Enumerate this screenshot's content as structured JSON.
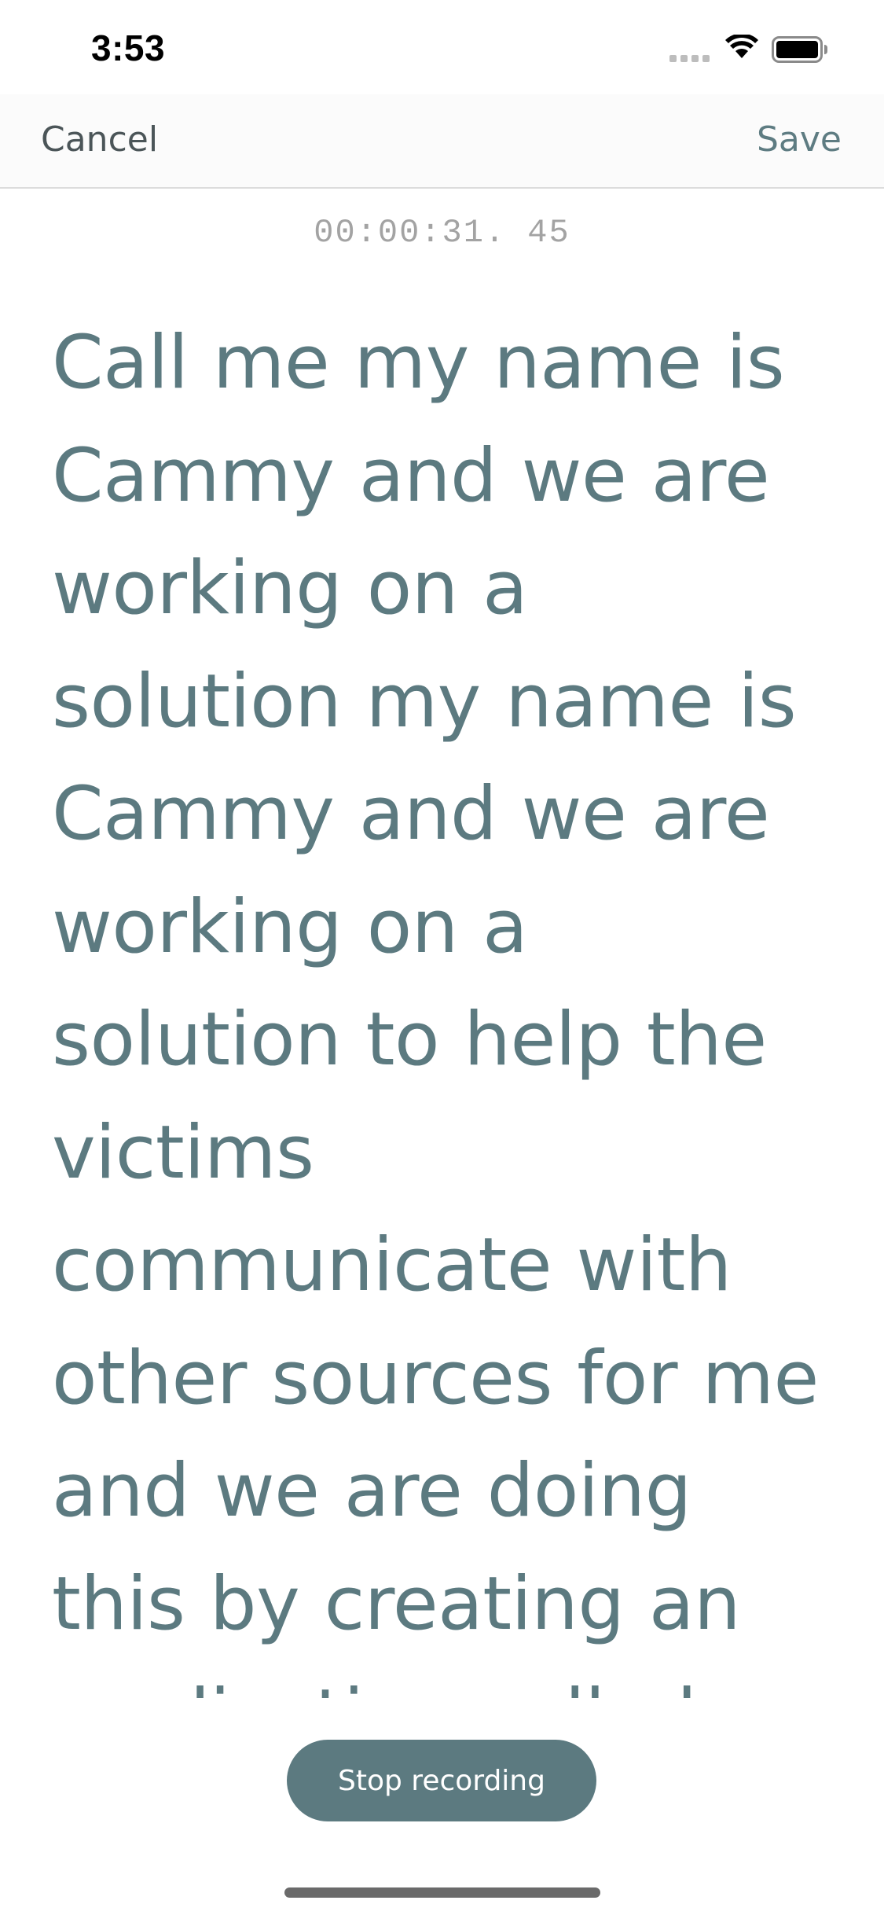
{
  "status_bar": {
    "time": "3:53",
    "icons": [
      "cellular-signal-icon",
      "wifi-icon",
      "battery-icon"
    ]
  },
  "nav": {
    "cancel_label": "Cancel",
    "save_label": "Save"
  },
  "timer": "00:00:31. 45",
  "transcript": {
    "text": "Call me my name is\nCammy and we are\nworking on a\nsolution my name is\nCammy and we are\nworking on a\nsolution to help the\nvictims\ncommunicate with\nother sources for me\nand we are doing\nthis by creating an\napplication called"
  },
  "actions": {
    "stop_label": "Stop recording"
  },
  "colors": {
    "accent": "#5c7a80",
    "cancel_text": "#4b5558",
    "timer_text": "#a3a3a3",
    "nav_background": "#fbfbfb"
  }
}
